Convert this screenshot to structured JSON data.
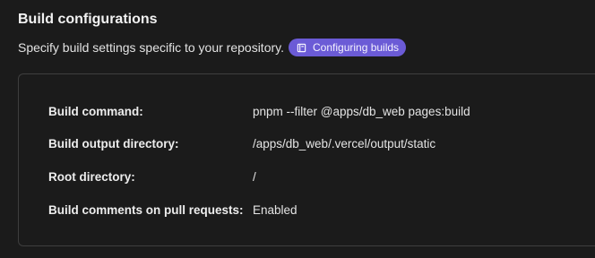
{
  "section": {
    "title": "Build configurations",
    "subtitle": "Specify build settings specific to your repository.",
    "doc_link": {
      "label": "Configuring builds",
      "icon": "book-icon"
    }
  },
  "settings": [
    {
      "label": "Build command:",
      "value": "pnpm --filter @apps/db_web pages:build"
    },
    {
      "label": "Build output directory:",
      "value": "/apps/db_web/.vercel/output/static"
    },
    {
      "label": "Root directory:",
      "value": "/"
    },
    {
      "label": "Build comments on pull requests:",
      "value": "Enabled"
    }
  ],
  "colors": {
    "background": "#1b1b1b",
    "accent": "#6b5bd6",
    "border": "#3e3e3e"
  }
}
